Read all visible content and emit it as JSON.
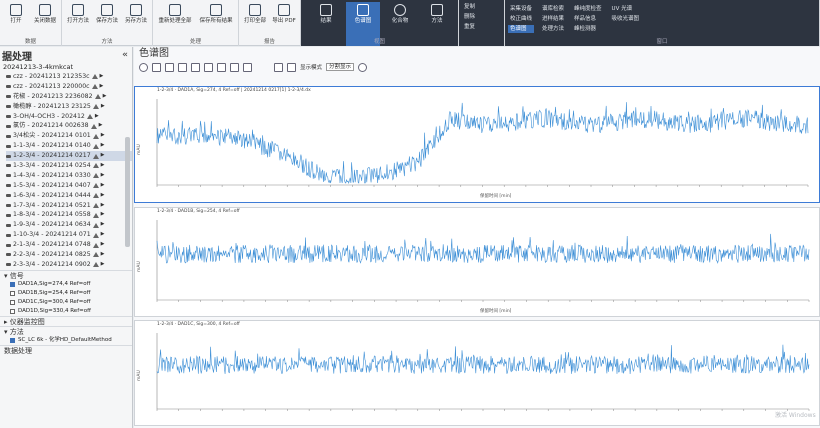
{
  "ribbon": {
    "group1": {
      "label": "数据",
      "buttons": [
        "打开",
        "关闭数据"
      ]
    },
    "group2": {
      "label": "方法",
      "buttons": [
        "打开方法",
        "保存方法",
        "另存方法"
      ]
    },
    "group3": {
      "label": "处理",
      "buttons": [
        "重新处理全部",
        "保存所有结果"
      ]
    },
    "group4": {
      "label": "报告",
      "buttons": [
        "打印全部",
        "导出 PDF"
      ]
    },
    "group5": {
      "label": "视图",
      "buttons": [
        "结果",
        "色谱图",
        "化合物",
        "方法"
      ],
      "selected": "色谱图"
    },
    "group6": {
      "items": [
        "复制",
        "删除",
        "重复"
      ]
    },
    "group7": {
      "label": "窗口",
      "col1": [
        "采集设备",
        "校正曲线",
        "色谱图"
      ],
      "col2": [
        "谱库检索",
        "进样结果",
        "处理方法"
      ],
      "col3": [
        "峰纯度检查",
        "样品信息",
        "峰检测器"
      ],
      "col4": [
        "UV 光谱",
        "吸收光谱图"
      ]
    }
  },
  "left": {
    "title": "据处理",
    "collapse": "«",
    "root": "20241213-3-4kmkcat",
    "items": [
      "czz - 20241213 212353c",
      "czz - 20241213 220000c",
      "花椒 - 20241213 2236082",
      "橄榄醇 - 20241213 23125",
      "3-OH/4-OCH3 - 202412",
      "氯仿 - 20241214 002638",
      "3/4松尖 - 20241214 0101",
      "1-1-3/4 - 20241214 0140",
      "1-2-3/4 - 20241214 0217",
      "1-3-3/4 - 20241214 0254",
      "1-4-3/4 - 20241214 0330",
      "1-5-3/4 - 20241214 0407",
      "1-6-3/4 - 20241214 0444",
      "1-7-3/4 - 20241214 0521",
      "1-8-3/4 - 20241214 0558",
      "1-9-3/4 - 20241214 0634",
      "1-10-3/4 - 20241214 071",
      "2-1-3/4 - 20241214 0748",
      "2-2-3/4 - 20241214 0825",
      "2-3-3/4 - 20241214 0902"
    ],
    "selected_index": 8,
    "signal_section": "信号",
    "signals": [
      {
        "label": "DAD1A,Sig=274,4 Ref=off",
        "checked": true
      },
      {
        "label": "DAD1B,Sig=254,4 Ref=off",
        "checked": false
      },
      {
        "label": "DAD1C,Sig=300,4 Ref=off",
        "checked": false
      },
      {
        "label": "DAD1D,Sig=330,4 Ref=off",
        "checked": false
      }
    ],
    "sec_instrument": "仪器监控图",
    "sec_method": "方法",
    "method_item": "SC_LC 6k - 化学HD_DefaultMethod",
    "sec_data": "数据处理"
  },
  "main": {
    "title": "色谱图",
    "display_mode_label": "显示模式",
    "display_mode_value": "分割显示"
  },
  "plots": [
    {
      "header": "1-2-3/4 · DAD1A, Sig=274, 4 Ref=off | 20241214 0217[1] 1-2-3/4.dx",
      "ylabel": "mAU",
      "xlabel": "保留时间 [min]"
    },
    {
      "header": "1-2-3/4 · DAD1B, Sig=254, 4 Ref=off",
      "ylabel": "mAU",
      "xlabel": "保留时间 [min]"
    },
    {
      "header": "1-2-3/4 · DAD1C, Sig=300, 4 Ref=off",
      "ylabel": "mAU",
      "xlabel": ""
    }
  ],
  "watermark": "激活 Windows",
  "colors": {
    "trace": "#3d8fd6",
    "accent": "#3a6fb7",
    "active_border": "#3d7bd6"
  }
}
